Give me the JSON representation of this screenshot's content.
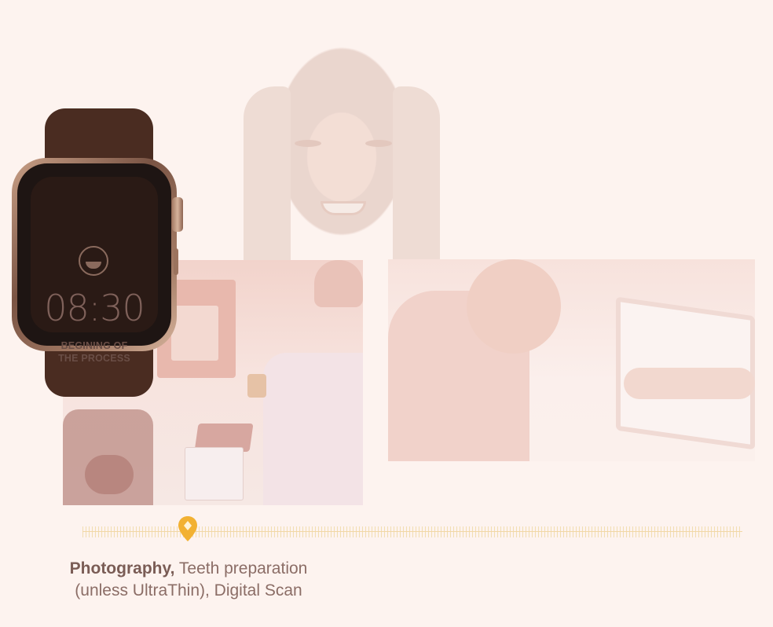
{
  "watch": {
    "time": "08:30",
    "caption_line1": "BEGINING OF",
    "caption_line2": "THE PROCESS",
    "face_icon": "smile-icon"
  },
  "timeline": {
    "marker_icon": "location-pin-icon",
    "accent_color": "#f2b132",
    "progress": 0.16
  },
  "stage": {
    "title": "Photography,",
    "description_line1": " Teeth preparation",
    "description_line2": "(unless UltraThin), Digital Scan"
  },
  "colors": {
    "background": "#fdf3ef",
    "text": "#8b6d66",
    "strap": "#4a2c21"
  }
}
